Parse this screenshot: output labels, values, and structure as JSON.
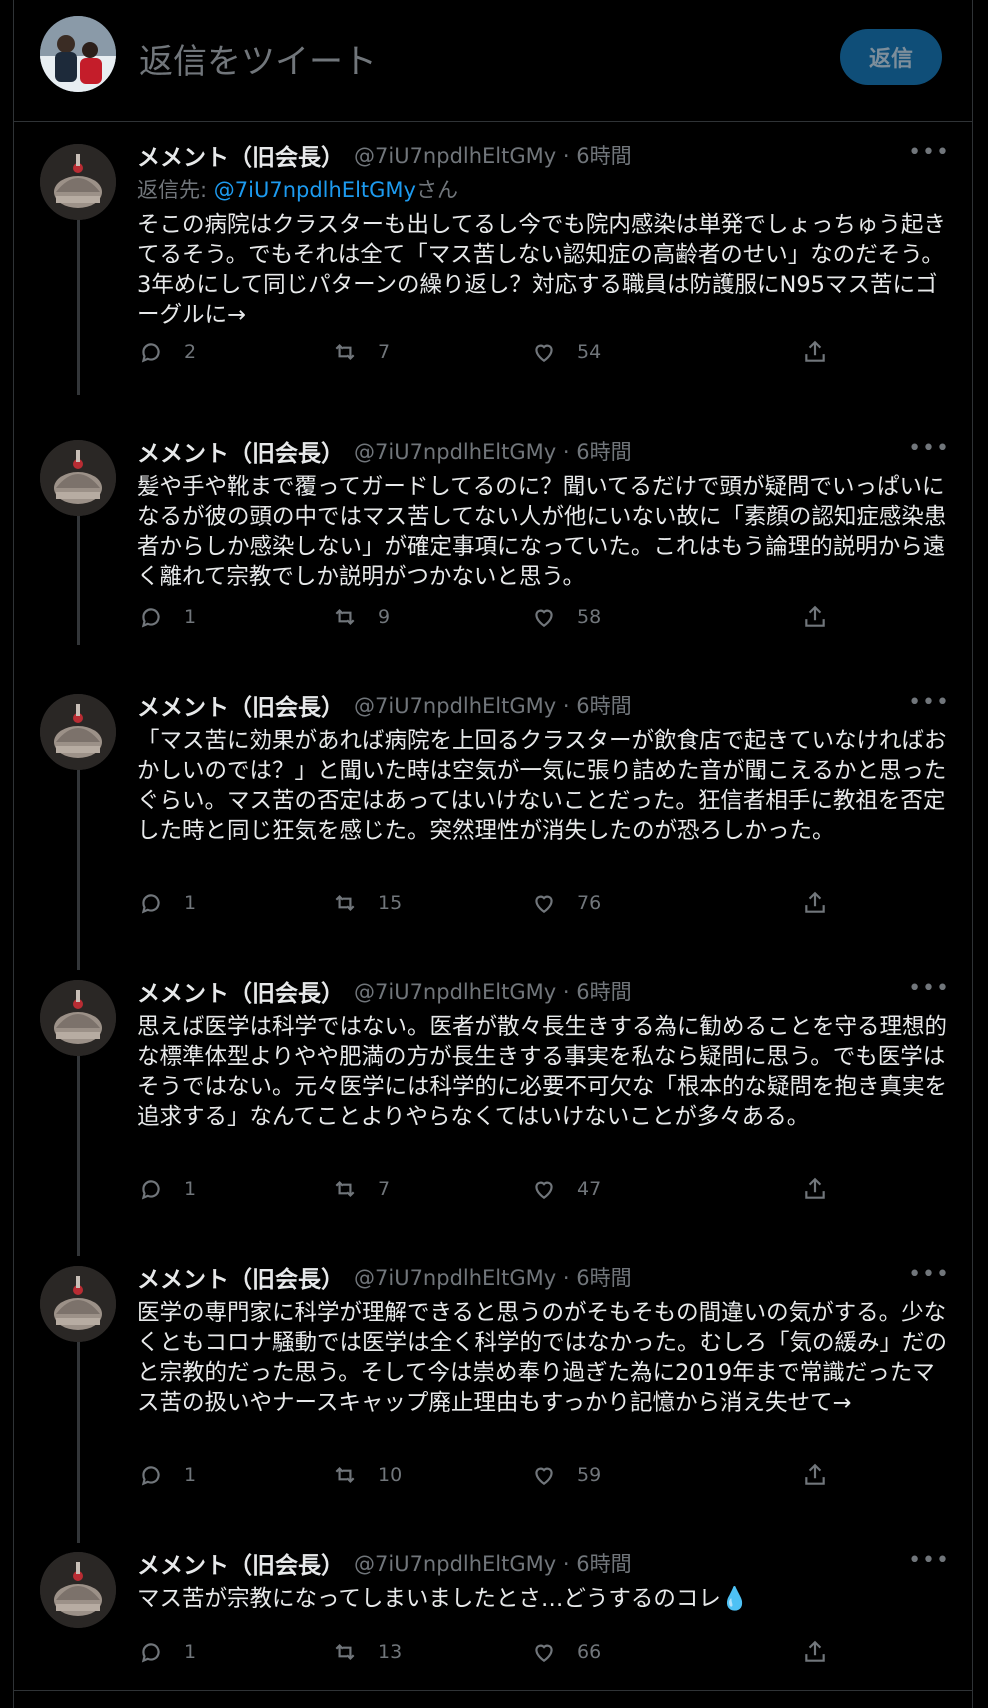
{
  "reply_bar": {
    "placeholder": "返信をツイート",
    "button": "返信"
  },
  "accent_color": "#1d9bf0",
  "tweets": [
    {
      "name": "メメント（旧会長）",
      "handle": "@7iU7npdlhEltGMy · 6時間",
      "reply_to_prefix": "返信先: ",
      "reply_to_mention": "@7iU7npdlhEltGMy",
      "reply_to_suffix": "さん",
      "text": "そこの病院はクラスターも出してるし今でも院内感染は単発でしょっちゅう起きてるそう。でもそれは全て「マス苦しない認知症の高齢者のせい」なのだそう。3年めにして同じパターンの繰り返し？対応する職員は防護服にN95マス苦にゴーグルに→",
      "replies": "2",
      "retweets": "7",
      "likes": "54"
    },
    {
      "name": "メメント（旧会長）",
      "handle": "@7iU7npdlhEltGMy · 6時間",
      "text": "髪や手や靴まで覆ってガードしてるのに？聞いてるだけで頭が疑問でいっぱいになるが彼の頭の中ではマス苦してない人が他にいない故に「素顔の認知症感染患者からしか感染しない」が確定事項になっていた。これはもう論理的説明から遠く離れて宗教でしか説明がつかないと思う。",
      "replies": "1",
      "retweets": "9",
      "likes": "58"
    },
    {
      "name": "メメント（旧会長）",
      "handle": "@7iU7npdlhEltGMy · 6時間",
      "text": "「マス苦に効果があれば病院を上回るクラスターが飲食店で起きていなければおかしいのでは？」と聞いた時は空気が一気に張り詰めた音が聞こえるかと思ったぐらい。マス苦の否定はあってはいけないことだった。狂信者相手に教祖を否定した時と同じ狂気を感じた。突然理性が消失したのが恐ろしかった。",
      "replies": "1",
      "retweets": "15",
      "likes": "76"
    },
    {
      "name": "メメント（旧会長）",
      "handle": "@7iU7npdlhEltGMy · 6時間",
      "text": "思えば医学は科学ではない。医者が散々長生きする為に勧めることを守る理想的な標準体型よりやや肥満の方が長生きする事実を私なら疑問に思う。でも医学はそうではない。元々医学には科学的に必要不可欠な「根本的な疑問を抱き真実を追求する」なんてことよりやらなくてはいけないことが多々ある。",
      "replies": "1",
      "retweets": "7",
      "likes": "47"
    },
    {
      "name": "メメント（旧会長）",
      "handle": "@7iU7npdlhEltGMy · 6時間",
      "text": "医学の専門家に科学が理解できると思うのがそもそもの間違いの気がする。少なくともコロナ騒動では医学は全く科学的ではなかった。むしろ「気の緩み」だのと宗教的だった思う。そして今は崇め奉り過ぎた為に2019年まで常識だったマス苦の扱いやナースキャップ廃止理由もすっかり記憶から消え失せて→",
      "replies": "1",
      "retweets": "10",
      "likes": "59"
    },
    {
      "name": "メメント（旧会長）",
      "handle": "@7iU7npdlhEltGMy · 6時間",
      "text": "マス苦が宗教になってしまいましたとさ…どうするのコレ💧",
      "replies": "1",
      "retweets": "13",
      "likes": "66"
    }
  ]
}
